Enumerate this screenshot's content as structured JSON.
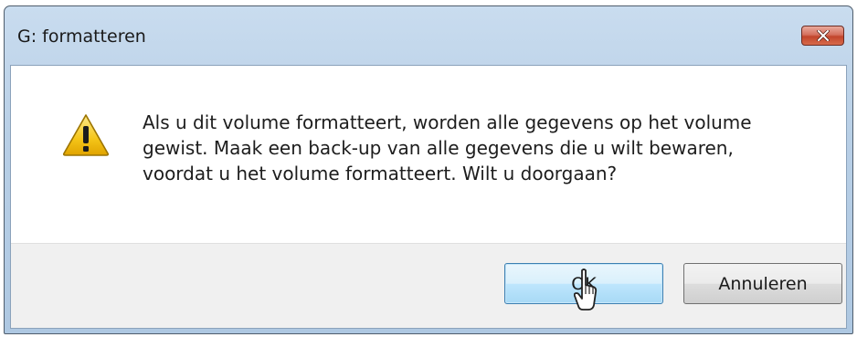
{
  "window": {
    "title": "G: formatteren"
  },
  "dialog": {
    "message": "Als u dit volume formatteert, worden alle gegevens op het volume\ngewist. Maak een back-up van alle gegevens die u wilt bewaren,\nvoordat u het volume formatteert. Wilt u doorgaan?",
    "icon": "warning-icon"
  },
  "buttons": {
    "ok_label": "OK",
    "cancel_label": "Annuleren"
  },
  "colors": {
    "warning_fill": "#f5c518",
    "close_red": "#c2452c",
    "accent_button_border": "#3c7fb1"
  }
}
